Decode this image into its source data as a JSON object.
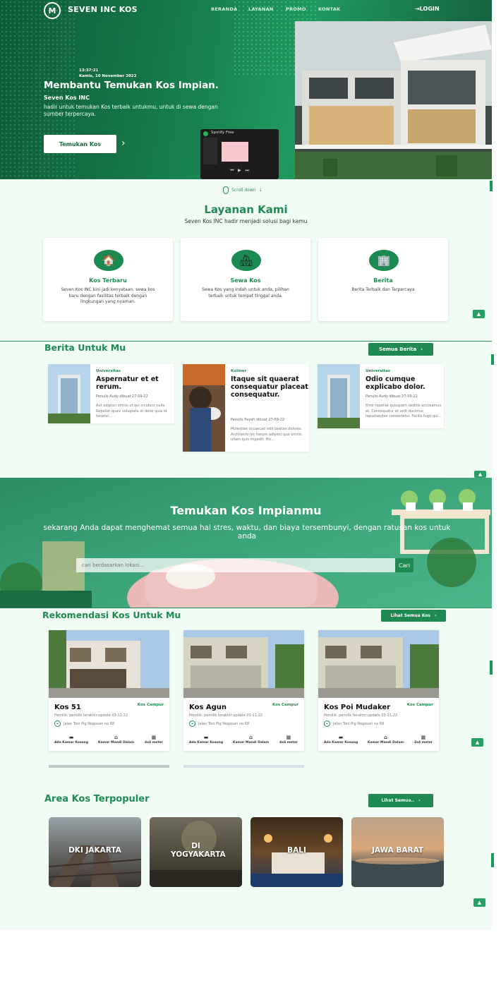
{
  "brand": {
    "logo_letter": "M",
    "name": "SEVEN INC KOS"
  },
  "nav": {
    "items": [
      "BERANDA",
      "LAYANAN",
      "PROMO",
      "KONTAK"
    ],
    "login": "LOGIN"
  },
  "hero": {
    "time": "13:37:21",
    "date": "Kamis, 10 November 2022",
    "title": "Membantu Temukan Kos Impian.",
    "subtitle": "Seven Kos INC",
    "description": "hadir untuk temukan Kos terbaik untukmu, untuk di sewa dengan sumber terpercaya.",
    "cta": "Temukan Kos",
    "player_title": "Spotify Free"
  },
  "scroll_down": "Scroll down",
  "layanan": {
    "title": "Layanan Kami",
    "subtitle": "Seven Kos INC hadir menjadi solusi bagi kamu",
    "cards": [
      {
        "icon": "house-icon",
        "title": "Kos Terbaru",
        "desc": "Seven Kos INC kini jadi kenyataan, sewa kos baru dengan fasilitas terbaik dengan lingkungan yang nyaman."
      },
      {
        "icon": "rent-icon",
        "title": "Sewa Kos",
        "desc": "Sewa Kos yang indah untuk anda, pilihan terbaik untuk tempat tinggal anda."
      },
      {
        "icon": "building-icon",
        "title": "Berita",
        "desc": "Berita Terbaik dan Terpercaya"
      }
    ]
  },
  "berita": {
    "title": "Berita Untuk Mu",
    "button": "Semua Berita",
    "items": [
      {
        "category": "Universitas",
        "title": "Aspernatur et et rerum.",
        "meta": "Penulis Audy dibuat 27-09-22",
        "excerpt": "Aut adipisci omnis ut qui incidunt nulla. Repellat quasi voluptate et dolor quia id tenetur..."
      },
      {
        "category": "Kuliner",
        "title": "Itaque sit quaerat consequatur placeat consequatur.",
        "meta": "Penulis Payah dibuat 27-09-22",
        "excerpt": "Molestiae occaecati odit beatae dolores. Architecto hic harum adipisci quo omnis ullam quis impedit. Hic..."
      },
      {
        "category": "Universitas",
        "title": "Odio cumque explicabo dolor.",
        "meta": "Penulis Audy dibuat 27-09-22",
        "excerpt": "Error repellat quisquam deditis accusamus et. Consequatur et velit ducimus repudiandae consectetur. Facilis fugit qui..."
      }
    ]
  },
  "search": {
    "title": "Temukan Kos Impianmu",
    "subtitle": "sekarang Anda dapat menghemat semua hal stres, waktu, dan biaya tersembunyi, dengan ratusan kos untuk anda",
    "placeholder": "cari berdasarkan lokasi...",
    "button": "Cari"
  },
  "rekomendasi": {
    "title": "Rekomendasi Kos Untuk Mu",
    "button": "Lihat Semua Kos",
    "items": [
      {
        "name": "Kos 51",
        "type": "Kos Campur",
        "meta": "Pemilik: pemilik terakhir update 03-11-22",
        "address": "Jalan Toni Pig Nogosari no 68",
        "facilities": [
          "Ada Kamar Kosong",
          "Kamar Mandi Dalam",
          "4x4 meter"
        ]
      },
      {
        "name": "Kos Agun",
        "type": "Kos Campur",
        "meta": "Pemilik: pemilik terakhir update 03-11-22",
        "address": "Jalan Toni Pig Nogosari no 68",
        "facilities": [
          "Ada Kamar Kosong",
          "Kamar Mandi Dalam",
          "4x4 meter"
        ]
      },
      {
        "name": "Kos Poi Mudaker",
        "type": "Kos Campur",
        "meta": "Pemilik: pemilik terakhir update 03-11-22",
        "address": "Jalan Toni Pig Nogosari no 68",
        "facilities": [
          "Ada Kamar Kosong",
          "Kamar Mandi Dalam",
          "4x4 meter"
        ]
      }
    ]
  },
  "area": {
    "title": "Area Kos Terpopuler",
    "button": "Lihat Semua..",
    "items": [
      "DKI JAKARTA",
      "DI YOGYAKARTA",
      "BALI",
      "JAWA BARAT"
    ]
  },
  "colors": {
    "primary": "#1f8a54",
    "hero_dark": "#0f5b38",
    "bg_light": "#f1fcf5"
  }
}
